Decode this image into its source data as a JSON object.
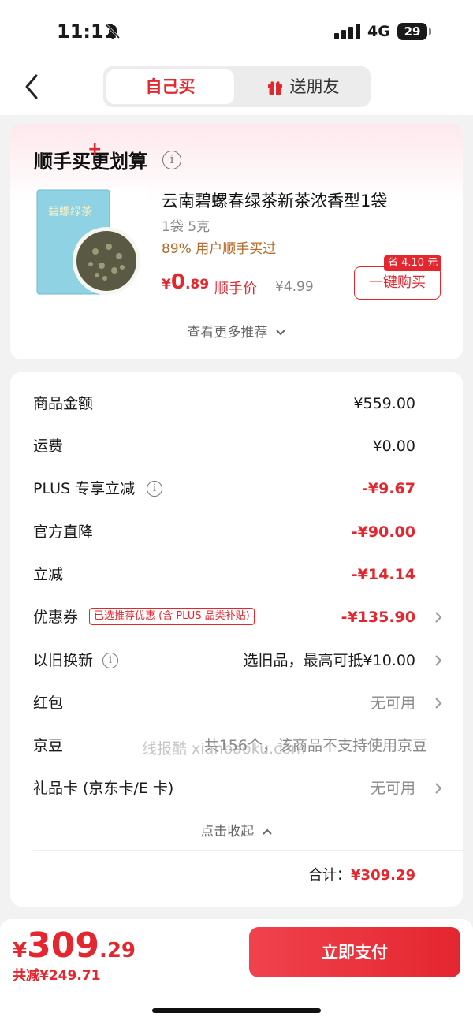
{
  "status_bar": {
    "time": "11:11",
    "network": "4G",
    "battery": "29"
  },
  "tabs": {
    "self": "自己买",
    "gift": "送朋友"
  },
  "promo": {
    "title": "顺手买更划算",
    "product_name": "云南碧螺春绿茶新茶浓香型1袋",
    "spec": "1袋 5克",
    "bought": "89% 用户顺手买过",
    "price_currency": "¥",
    "price_int": "0",
    "price_dec": ".89",
    "price_label": "顺手价",
    "original_price": "¥4.99",
    "save_tag": "省 4.10 元",
    "buy_button": "一键购买",
    "package_text": "碧螺绿茶",
    "more": "查看更多推荐"
  },
  "details": {
    "rows": [
      {
        "label": "商品金额",
        "value": "¥559.00"
      },
      {
        "label": "运费",
        "value": "¥0.00"
      },
      {
        "label": "PLUS 专享立减",
        "value": "-¥9.67"
      },
      {
        "label": "官方直降",
        "value": "-¥90.00"
      },
      {
        "label": "立减",
        "value": "-¥14.14"
      },
      {
        "label": "优惠券",
        "tag": "已选推荐优惠 (含 PLUS 品类补贴)",
        "value": "-¥135.90"
      },
      {
        "label": "以旧换新",
        "value": "选旧品，最高可抵¥10.00"
      },
      {
        "label": "红包",
        "value": "无可用"
      },
      {
        "label": "京豆",
        "value": "共156个，该商品不支持使用京豆"
      },
      {
        "label": "礼品卡 (京东卡/E 卡)",
        "value": "无可用"
      }
    ],
    "watermark": "线报酷 xianbaoku.com",
    "collapse": "点击收起",
    "total_label": "合计：",
    "total_value": "¥309.29"
  },
  "bottom": {
    "currency": "¥",
    "price_int": "309",
    "price_dec": ".29",
    "saved": "共减¥249.71",
    "pay_button": "立即支付"
  },
  "colors": {
    "accent": "#e4262f",
    "coupon_gold": "#b46a2a"
  }
}
